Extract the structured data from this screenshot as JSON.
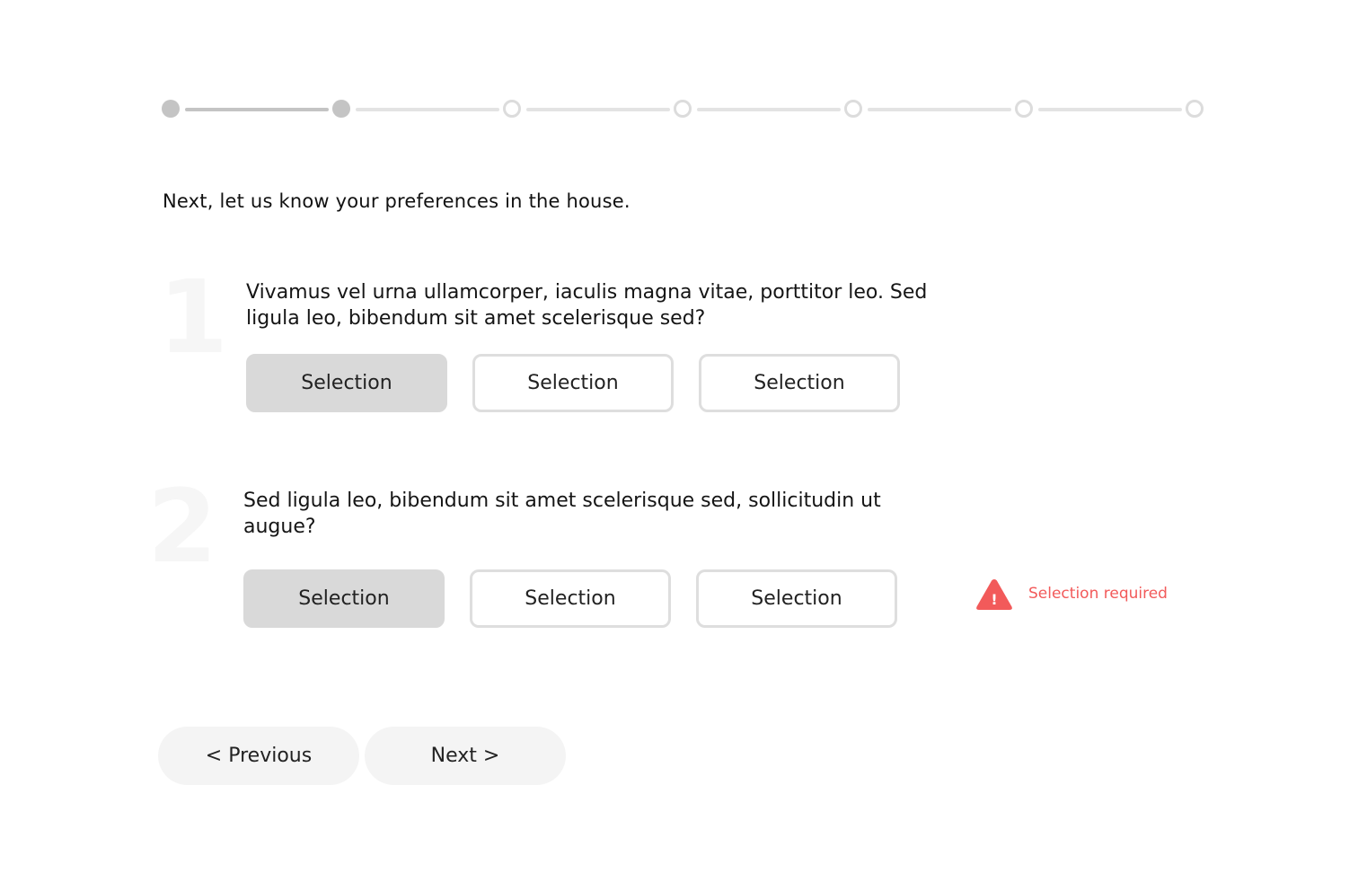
{
  "stepper": {
    "total_steps": 7,
    "completed_steps": 2
  },
  "intro": "Next, let us know your preferences in the house.",
  "questions": [
    {
      "number": "1",
      "text": "Vivamus vel urna ullamcorper, iaculis magna vitae, porttitor leo. Sed ligula leo, bibendum sit amet scelerisque sed?",
      "options": [
        "Selection",
        "Selection",
        "Selection"
      ],
      "selected_index": 0
    },
    {
      "number": "2",
      "text": "Sed ligula leo, bibendum sit amet scelerisque sed, sollicitudin ut augue?",
      "options": [
        "Selection",
        "Selection",
        "Selection"
      ],
      "selected_index": 0
    }
  ],
  "error": {
    "icon": "warning-triangle-icon",
    "glyph": "!",
    "message": "Selection required",
    "color": "#f25a5a"
  },
  "nav": {
    "previous_label": "< Previous",
    "next_label": "Next >"
  }
}
